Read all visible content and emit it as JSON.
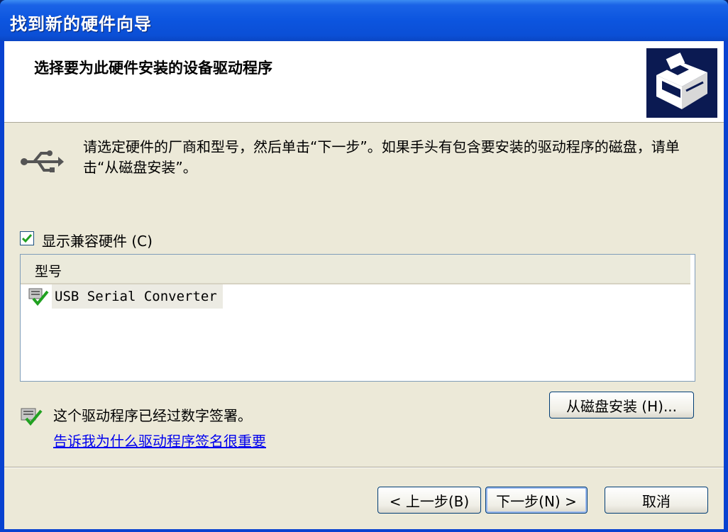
{
  "window": {
    "title": "找到新的硬件向导"
  },
  "header": {
    "heading": "选择要为此硬件安装的设备驱动程序"
  },
  "instruction": "请选定硬件的厂商和型号，然后单击“下一步”。如果手头有包含要安装的驱动程序的磁盘，请单击“从磁盘安装”。",
  "show_compatible": {
    "label": "显示兼容硬件 (C)",
    "checked": true
  },
  "list": {
    "column_header": "型号",
    "items": [
      {
        "label": "USB Serial Converter",
        "selected": true
      }
    ]
  },
  "have_disk_button": "从磁盘安装 (H)...",
  "signature": {
    "status_text": "这个驱动程序已经过数字签署。",
    "link_text": "告诉我为什么驱动程序签名很重要"
  },
  "buttons": {
    "back": "< 上一步(B)",
    "next": "下一步(N) >",
    "cancel": "取消"
  },
  "icons": {
    "hardware": "hardware-drive-icon",
    "usb": "usb-icon",
    "driver": "signed-driver-icon"
  }
}
